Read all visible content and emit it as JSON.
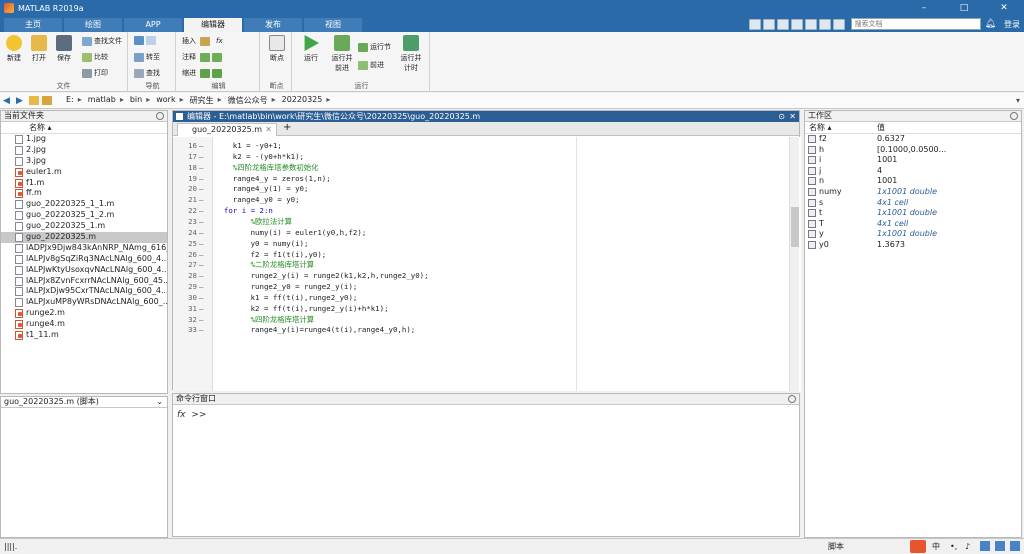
{
  "window": {
    "title": "MATLAB R2019a"
  },
  "ribbon_tabs": [
    "主页",
    "绘图",
    "APP",
    "编辑器",
    "发布",
    "视图"
  ],
  "active_tab": "编辑器",
  "search": {
    "placeholder": "搜索文档"
  },
  "login_label": "登录",
  "ribbon": {
    "file_group": {
      "label": "文件",
      "new": "新建",
      "open": "打开",
      "save": "保存",
      "find_files": "查找文件",
      "compare": "比较",
      "print": "打印"
    },
    "nav_group": {
      "label": "导航",
      "goto": "转至",
      "find": "查找"
    },
    "edit_group": {
      "label": "编辑",
      "insert": "插入",
      "comment": "注释",
      "indent": "缩进"
    },
    "breakpoint_group": {
      "label": "断点",
      "breakpoints": "断点"
    },
    "run_group": {
      "label": "运行",
      "run": "运行",
      "run_advance": "运行并前进",
      "run_section": "运行节",
      "advance": "前进",
      "run_time": "运行并计时"
    }
  },
  "address": {
    "path": [
      "E:",
      "matlab",
      "bin",
      "work",
      "研究生",
      "微信公众号",
      "20220325"
    ]
  },
  "current_folder": {
    "title": "当前文件夹",
    "col_name": "名称",
    "files": [
      {
        "name": "1.jpg",
        "type": "img"
      },
      {
        "name": "2.jpg",
        "type": "img"
      },
      {
        "name": "3.jpg",
        "type": "img"
      },
      {
        "name": "euler1.m",
        "type": "m"
      },
      {
        "name": "f1.m",
        "type": "m"
      },
      {
        "name": "ff.m",
        "type": "m"
      },
      {
        "name": "guo_20220325_1_1.m",
        "type": "file"
      },
      {
        "name": "guo_20220325_1_2.m",
        "type": "file"
      },
      {
        "name": "guo_20220325_1.m",
        "type": "file"
      },
      {
        "name": "guo_20220325.m",
        "type": "file"
      },
      {
        "name": "lADPJx9Djw843kAnNRP_NAmg_616_...",
        "type": "img"
      },
      {
        "name": "lALPJv8gSqZiRq3NAcLNAlg_600_4...",
        "type": "img"
      },
      {
        "name": "lALPJwKtyUsoxqvNAcLNAlg_600_4...",
        "type": "img"
      },
      {
        "name": "lALPJx8ZvnFcxrrNAcLNAlg_600_45...",
        "type": "img"
      },
      {
        "name": "lALPJxDjw95CxrTNAcLNAlg_600_4...",
        "type": "img"
      },
      {
        "name": "lALPJxuMP8yWRsDNAcLNAlg_600_...",
        "type": "img"
      },
      {
        "name": "runge2.m",
        "type": "m"
      },
      {
        "name": "runge4.m",
        "type": "m"
      },
      {
        "name": "t1_11.m",
        "type": "m"
      }
    ],
    "selected_index": 9
  },
  "details": {
    "label": "guo_20220325.m (脚本)"
  },
  "editor": {
    "title": "编辑器 - E:\\matlab\\bin\\work\\研究生\\微信公众号\\20220325\\guo_20220325.m",
    "tab_label": "guo_20220325.m",
    "lines": [
      {
        "n": "16",
        "text": "    k1 = -y0+1;",
        "cls": ""
      },
      {
        "n": "17",
        "text": "    k2 = -(y0+h*k1);",
        "cls": ""
      },
      {
        "n": "18",
        "text": "    %四阶龙格库塔参数初始化",
        "cls": "cm"
      },
      {
        "n": "19",
        "text": "    range4_y = zeros(1,n);",
        "cls": ""
      },
      {
        "n": "20",
        "text": "    range4_y(1) = y0;",
        "cls": ""
      },
      {
        "n": "21",
        "text": "    range4_y0 = y0;",
        "cls": ""
      },
      {
        "n": "22",
        "text": "  for i = 2:n",
        "cls": "kw"
      },
      {
        "n": "23",
        "text": "        %欧拉法计算",
        "cls": "cm"
      },
      {
        "n": "24",
        "text": "        numy(i) = euler1(y0,h,f2);",
        "cls": ""
      },
      {
        "n": "25",
        "text": "        y0 = numy(i);",
        "cls": ""
      },
      {
        "n": "26",
        "text": "        f2 = f1(t(i),y0);",
        "cls": ""
      },
      {
        "n": "27",
        "text": "        %二阶龙格库塔计算",
        "cls": "cm"
      },
      {
        "n": "28",
        "text": "        runge2_y(i) = runge2(k1,k2,h,runge2_y0);",
        "cls": ""
      },
      {
        "n": "29",
        "text": "        runge2_y0 = runge2_y(i);",
        "cls": ""
      },
      {
        "n": "30",
        "text": "        k1 = ff(t(i),runge2_y0);",
        "cls": ""
      },
      {
        "n": "31",
        "text": "        k2 = ff(t(i),runge2_y(i)+h*k1);",
        "cls": ""
      },
      {
        "n": "32",
        "text": "        %四阶龙格库塔计算",
        "cls": "cm"
      },
      {
        "n": "33",
        "text": "        range4_y(i)=runge4(t(i),range4_y0,h);",
        "cls": ""
      }
    ]
  },
  "command_window": {
    "title": "命令行窗口",
    "prompt": ">>",
    "fx": "fx"
  },
  "workspace": {
    "title": "工作区",
    "col_name": "名称",
    "col_value": "值",
    "vars": [
      {
        "name": "f2",
        "value": "0.6327",
        "italic": false
      },
      {
        "name": "h",
        "value": "[0.1000,0.0500...",
        "italic": false
      },
      {
        "name": "i",
        "value": "1001",
        "italic": false
      },
      {
        "name": "j",
        "value": "4",
        "italic": false
      },
      {
        "name": "n",
        "value": "1001",
        "italic": false
      },
      {
        "name": "numy",
        "value": "1x1001 double",
        "italic": true
      },
      {
        "name": "s",
        "value": "4x1 cell",
        "italic": true
      },
      {
        "name": "t",
        "value": "1x1001 double",
        "italic": true
      },
      {
        "name": "T",
        "value": "4x1 cell",
        "italic": true
      },
      {
        "name": "y",
        "value": "1x1001 double",
        "italic": true
      },
      {
        "name": "y0",
        "value": "1.3673",
        "italic": false
      }
    ]
  },
  "status": {
    "left": "||||.",
    "right": "脚本"
  }
}
